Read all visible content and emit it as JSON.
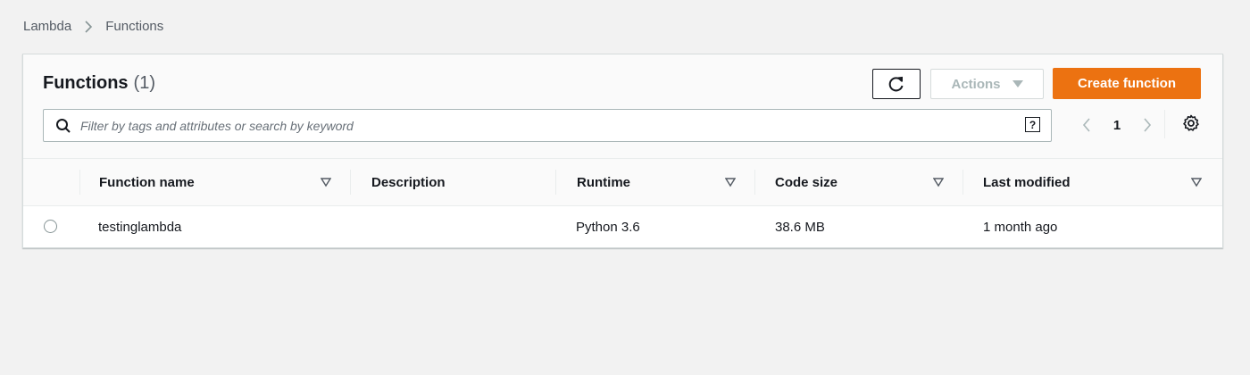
{
  "breadcrumb": {
    "root": "Lambda",
    "current": "Functions"
  },
  "panel": {
    "title": "Functions",
    "count": "(1)",
    "refresh_icon": "refresh-icon",
    "actions_label": "Actions",
    "create_label": "Create function",
    "accent_color": "#ec7211"
  },
  "search": {
    "placeholder": "Filter by tags and attributes or search by keyword",
    "help_glyph": "?"
  },
  "pagination": {
    "current_page": "1"
  },
  "table": {
    "columns": [
      "Function name",
      "Description",
      "Runtime",
      "Code size",
      "Last modified"
    ],
    "rows": [
      {
        "name": "testinglambda",
        "description": "",
        "runtime": "Python 3.6",
        "code_size": "38.6 MB",
        "last_modified": "1 month ago"
      }
    ]
  }
}
